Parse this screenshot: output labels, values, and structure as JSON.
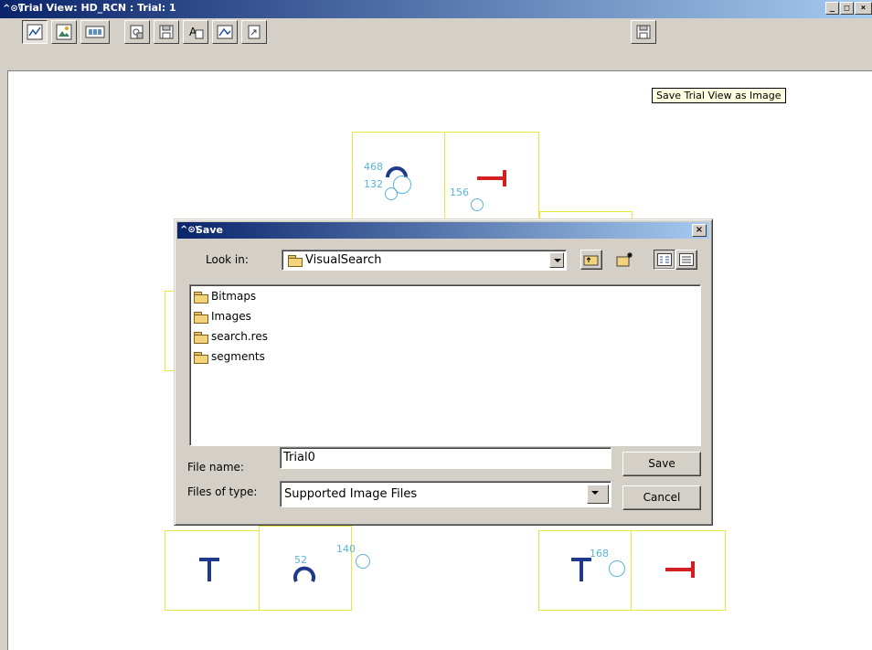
{
  "window": {
    "title": "Trial View: HD_RCN : Trial: 1",
    "app_icon": "^⊙\\",
    "minimize": "_",
    "maximize": "□",
    "close": "×"
  },
  "toolbar": {
    "buttons": [
      {
        "name": "line-chart-icon"
      },
      {
        "name": "image-view-icon"
      },
      {
        "name": "film-strip-icon"
      },
      {
        "name": "open-image-icon"
      },
      {
        "name": "save-icon"
      },
      {
        "name": "text-overlay-icon"
      },
      {
        "name": "picture-icon"
      },
      {
        "name": "export-icon"
      },
      {
        "name": "save-image-icon"
      }
    ]
  },
  "tooltip": "Save Trial View as Image",
  "canvas": {
    "labels": [
      "468",
      "132",
      "156",
      "140",
      "52",
      "168"
    ]
  },
  "dialog": {
    "title": "Save",
    "app_icon": "^⊙\\",
    "close": "×",
    "look_in_label": "Look in:",
    "look_in_value": "VisualSearch",
    "items": [
      "Bitmaps",
      "Images",
      "search.res",
      "segments"
    ],
    "file_name_label": "File name:",
    "file_name_value": "Trial0",
    "file_type_label": "Files of type:",
    "file_type_value": "Supported Image Files",
    "save_button": "Save",
    "cancel_button": "Cancel"
  },
  "colors": {
    "title_start": "#0a246a",
    "title_end": "#a6caf0",
    "box_outline": "#e8e83c",
    "fixation": "#5ab4d8",
    "target_t": "#1f3a8a",
    "target_red": "#d42020"
  }
}
